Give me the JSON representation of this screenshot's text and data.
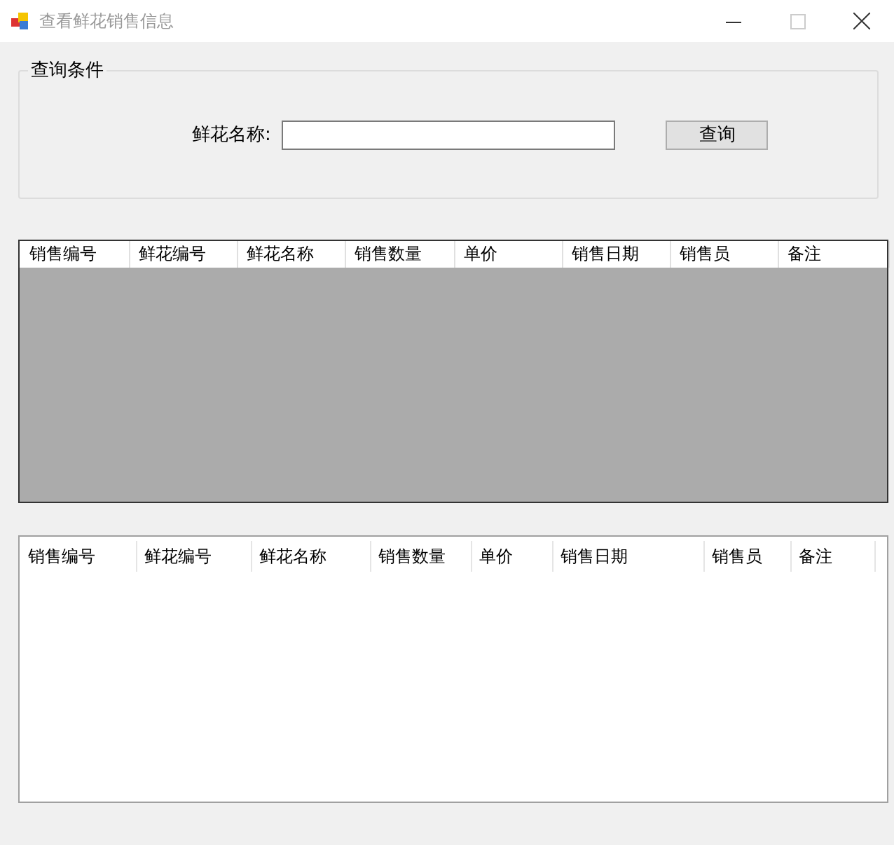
{
  "window": {
    "title": "查看鲜花销售信息"
  },
  "query_group": {
    "legend": "查询条件",
    "label": "鲜花名称:",
    "button": "查询"
  },
  "grid": {
    "columns": [
      "销售编号",
      "鲜花编号",
      "鲜花名称",
      "销售数量",
      "单价",
      "销售日期",
      "销售员",
      "备注"
    ]
  },
  "list": {
    "columns": [
      "销售编号",
      "鲜花编号",
      "鲜花名称",
      "销售数量",
      "单价",
      "销售日期",
      "销售员",
      "备注"
    ]
  }
}
